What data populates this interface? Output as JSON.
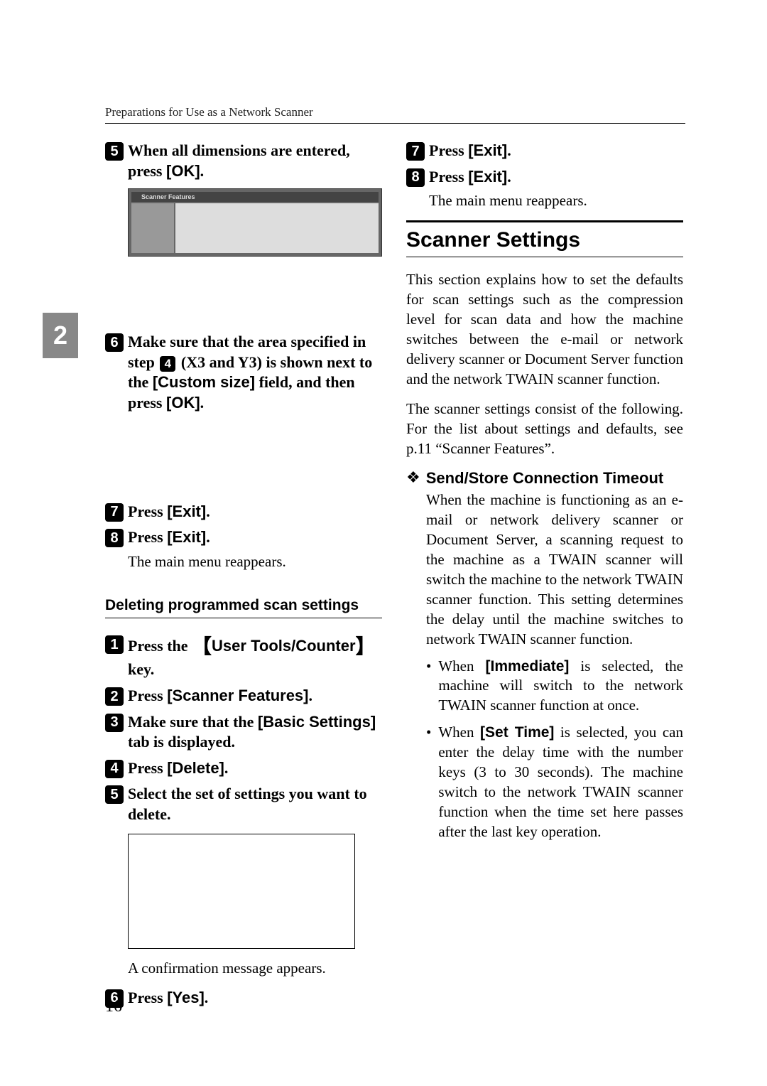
{
  "header": "Preparations for Use as a Network Scanner",
  "side_tab": "2",
  "left": {
    "step5": {
      "num": "5",
      "pre": "When all dimensions are entered, press ",
      "btn": "[OK]",
      "post": "."
    },
    "screenshot": {
      "titlebar": "Scanner Features"
    },
    "step6": {
      "num": "6",
      "t1": "Make sure that the area specified in step ",
      "inline_num": "4",
      "t2": " (X3 and Y3) is shown next to the ",
      "btn": "[Custom size]",
      "t3": " field, and then press ",
      "btn2": "[OK]",
      "t4": "."
    },
    "step7": {
      "num": "7",
      "pre": "Press ",
      "btn": "[Exit]",
      "post": "."
    },
    "step8": {
      "num": "8",
      "pre": "Press ",
      "btn": "[Exit]",
      "post": "."
    },
    "step8_body": "The main menu reappears.",
    "subheading": "Deleting programmed scan settings",
    "d1": {
      "num": "1",
      "pre": "Press the ",
      "key": "User Tools/Counter",
      "post": " key."
    },
    "d2": {
      "num": "2",
      "pre": "Press ",
      "btn": "[Scanner Features]",
      "post": "."
    },
    "d3": {
      "num": "3",
      "pre": "Make sure that the ",
      "btn": "[Basic Settings]",
      "post": " tab is displayed."
    },
    "d4": {
      "num": "4",
      "pre": "Press ",
      "btn": "[Delete]",
      "post": "."
    },
    "d5": {
      "num": "5",
      "text": "Select the set of settings you want to delete."
    },
    "d5_body": "A confirmation message appears.",
    "d6": {
      "num": "6",
      "pre": "Press ",
      "btn": "[Yes]",
      "post": "."
    }
  },
  "right": {
    "step7": {
      "num": "7",
      "pre": "Press ",
      "btn": "[Exit]",
      "post": "."
    },
    "step8": {
      "num": "8",
      "pre": "Press ",
      "btn": "[Exit]",
      "post": "."
    },
    "step8_body": "The main menu reappears.",
    "heading": "Scanner Settings",
    "para1": "This section explains how to set the defaults for scan settings such as the compression level for scan data and how the machine switches between the e-mail or network delivery scanner or Document Server function and the network TWAIN scanner function.",
    "para2": "The scanner settings consist of the following. For the list about settings and defaults, see p.11 “Scanner Features”.",
    "bullet_title": "Send/Store Connection Timeout",
    "bullet_para": "When the machine is functioning as an e-mail or network delivery scanner or Document Server, a scanning request to the machine as a TWAIN scanner will switch the machine to the network TWAIN scanner function. This setting determines the delay until the machine switches to network TWAIN scanner function.",
    "li1": {
      "pre": "When ",
      "btn": "[Immediate]",
      "post": " is selected, the machine will switch to the network TWAIN scanner function at once."
    },
    "li2": {
      "pre": "When ",
      "btn": "[Set Time]",
      "post": " is selected, you can enter the delay time with the number keys (3 to 30 seconds). The machine switch to the network TWAIN scanner function when the time set here passes after the last key operation."
    }
  },
  "page_number": "16"
}
